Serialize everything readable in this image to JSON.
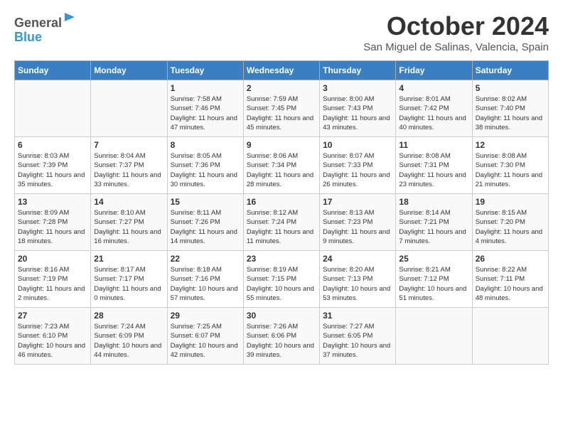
{
  "header": {
    "logo_line1": "General",
    "logo_line2": "Blue",
    "month": "October 2024",
    "location": "San Miguel de Salinas, Valencia, Spain"
  },
  "days_of_week": [
    "Sunday",
    "Monday",
    "Tuesday",
    "Wednesday",
    "Thursday",
    "Friday",
    "Saturday"
  ],
  "weeks": [
    [
      {
        "day": "",
        "info": ""
      },
      {
        "day": "",
        "info": ""
      },
      {
        "day": "1",
        "info": "Sunrise: 7:58 AM\nSunset: 7:46 PM\nDaylight: 11 hours and 47 minutes."
      },
      {
        "day": "2",
        "info": "Sunrise: 7:59 AM\nSunset: 7:45 PM\nDaylight: 11 hours and 45 minutes."
      },
      {
        "day": "3",
        "info": "Sunrise: 8:00 AM\nSunset: 7:43 PM\nDaylight: 11 hours and 43 minutes."
      },
      {
        "day": "4",
        "info": "Sunrise: 8:01 AM\nSunset: 7:42 PM\nDaylight: 11 hours and 40 minutes."
      },
      {
        "day": "5",
        "info": "Sunrise: 8:02 AM\nSunset: 7:40 PM\nDaylight: 11 hours and 38 minutes."
      }
    ],
    [
      {
        "day": "6",
        "info": "Sunrise: 8:03 AM\nSunset: 7:39 PM\nDaylight: 11 hours and 35 minutes."
      },
      {
        "day": "7",
        "info": "Sunrise: 8:04 AM\nSunset: 7:37 PM\nDaylight: 11 hours and 33 minutes."
      },
      {
        "day": "8",
        "info": "Sunrise: 8:05 AM\nSunset: 7:36 PM\nDaylight: 11 hours and 30 minutes."
      },
      {
        "day": "9",
        "info": "Sunrise: 8:06 AM\nSunset: 7:34 PM\nDaylight: 11 hours and 28 minutes."
      },
      {
        "day": "10",
        "info": "Sunrise: 8:07 AM\nSunset: 7:33 PM\nDaylight: 11 hours and 26 minutes."
      },
      {
        "day": "11",
        "info": "Sunrise: 8:08 AM\nSunset: 7:31 PM\nDaylight: 11 hours and 23 minutes."
      },
      {
        "day": "12",
        "info": "Sunrise: 8:08 AM\nSunset: 7:30 PM\nDaylight: 11 hours and 21 minutes."
      }
    ],
    [
      {
        "day": "13",
        "info": "Sunrise: 8:09 AM\nSunset: 7:28 PM\nDaylight: 11 hours and 18 minutes."
      },
      {
        "day": "14",
        "info": "Sunrise: 8:10 AM\nSunset: 7:27 PM\nDaylight: 11 hours and 16 minutes."
      },
      {
        "day": "15",
        "info": "Sunrise: 8:11 AM\nSunset: 7:26 PM\nDaylight: 11 hours and 14 minutes."
      },
      {
        "day": "16",
        "info": "Sunrise: 8:12 AM\nSunset: 7:24 PM\nDaylight: 11 hours and 11 minutes."
      },
      {
        "day": "17",
        "info": "Sunrise: 8:13 AM\nSunset: 7:23 PM\nDaylight: 11 hours and 9 minutes."
      },
      {
        "day": "18",
        "info": "Sunrise: 8:14 AM\nSunset: 7:21 PM\nDaylight: 11 hours and 7 minutes."
      },
      {
        "day": "19",
        "info": "Sunrise: 8:15 AM\nSunset: 7:20 PM\nDaylight: 11 hours and 4 minutes."
      }
    ],
    [
      {
        "day": "20",
        "info": "Sunrise: 8:16 AM\nSunset: 7:19 PM\nDaylight: 11 hours and 2 minutes."
      },
      {
        "day": "21",
        "info": "Sunrise: 8:17 AM\nSunset: 7:17 PM\nDaylight: 11 hours and 0 minutes."
      },
      {
        "day": "22",
        "info": "Sunrise: 8:18 AM\nSunset: 7:16 PM\nDaylight: 10 hours and 57 minutes."
      },
      {
        "day": "23",
        "info": "Sunrise: 8:19 AM\nSunset: 7:15 PM\nDaylight: 10 hours and 55 minutes."
      },
      {
        "day": "24",
        "info": "Sunrise: 8:20 AM\nSunset: 7:13 PM\nDaylight: 10 hours and 53 minutes."
      },
      {
        "day": "25",
        "info": "Sunrise: 8:21 AM\nSunset: 7:12 PM\nDaylight: 10 hours and 51 minutes."
      },
      {
        "day": "26",
        "info": "Sunrise: 8:22 AM\nSunset: 7:11 PM\nDaylight: 10 hours and 48 minutes."
      }
    ],
    [
      {
        "day": "27",
        "info": "Sunrise: 7:23 AM\nSunset: 6:10 PM\nDaylight: 10 hours and 46 minutes."
      },
      {
        "day": "28",
        "info": "Sunrise: 7:24 AM\nSunset: 6:09 PM\nDaylight: 10 hours and 44 minutes."
      },
      {
        "day": "29",
        "info": "Sunrise: 7:25 AM\nSunset: 6:07 PM\nDaylight: 10 hours and 42 minutes."
      },
      {
        "day": "30",
        "info": "Sunrise: 7:26 AM\nSunset: 6:06 PM\nDaylight: 10 hours and 39 minutes."
      },
      {
        "day": "31",
        "info": "Sunrise: 7:27 AM\nSunset: 6:05 PM\nDaylight: 10 hours and 37 minutes."
      },
      {
        "day": "",
        "info": ""
      },
      {
        "day": "",
        "info": ""
      }
    ]
  ]
}
